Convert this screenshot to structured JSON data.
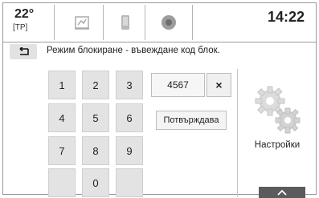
{
  "status": {
    "temperature": "22°",
    "temperature_sub": "[TP]",
    "time": "14:22"
  },
  "tabs": [
    {
      "icon": "audio-source-icon"
    },
    {
      "icon": "phone-icon"
    },
    {
      "icon": "navigation-icon"
    }
  ],
  "message": "Режим блокиране - въвеждане код блок.",
  "keypad": {
    "keys": [
      "1",
      "2",
      "3",
      "4",
      "5",
      "6",
      "7",
      "8",
      "9",
      "",
      "0",
      ""
    ]
  },
  "pin_input": {
    "value": "4567"
  },
  "clear_label": "×",
  "confirm_label": "Потвърждава",
  "settings_label": "Настройки",
  "colors": {
    "key_bg": "#e3e3e3",
    "collapse_bg": "#5b5b5b"
  }
}
